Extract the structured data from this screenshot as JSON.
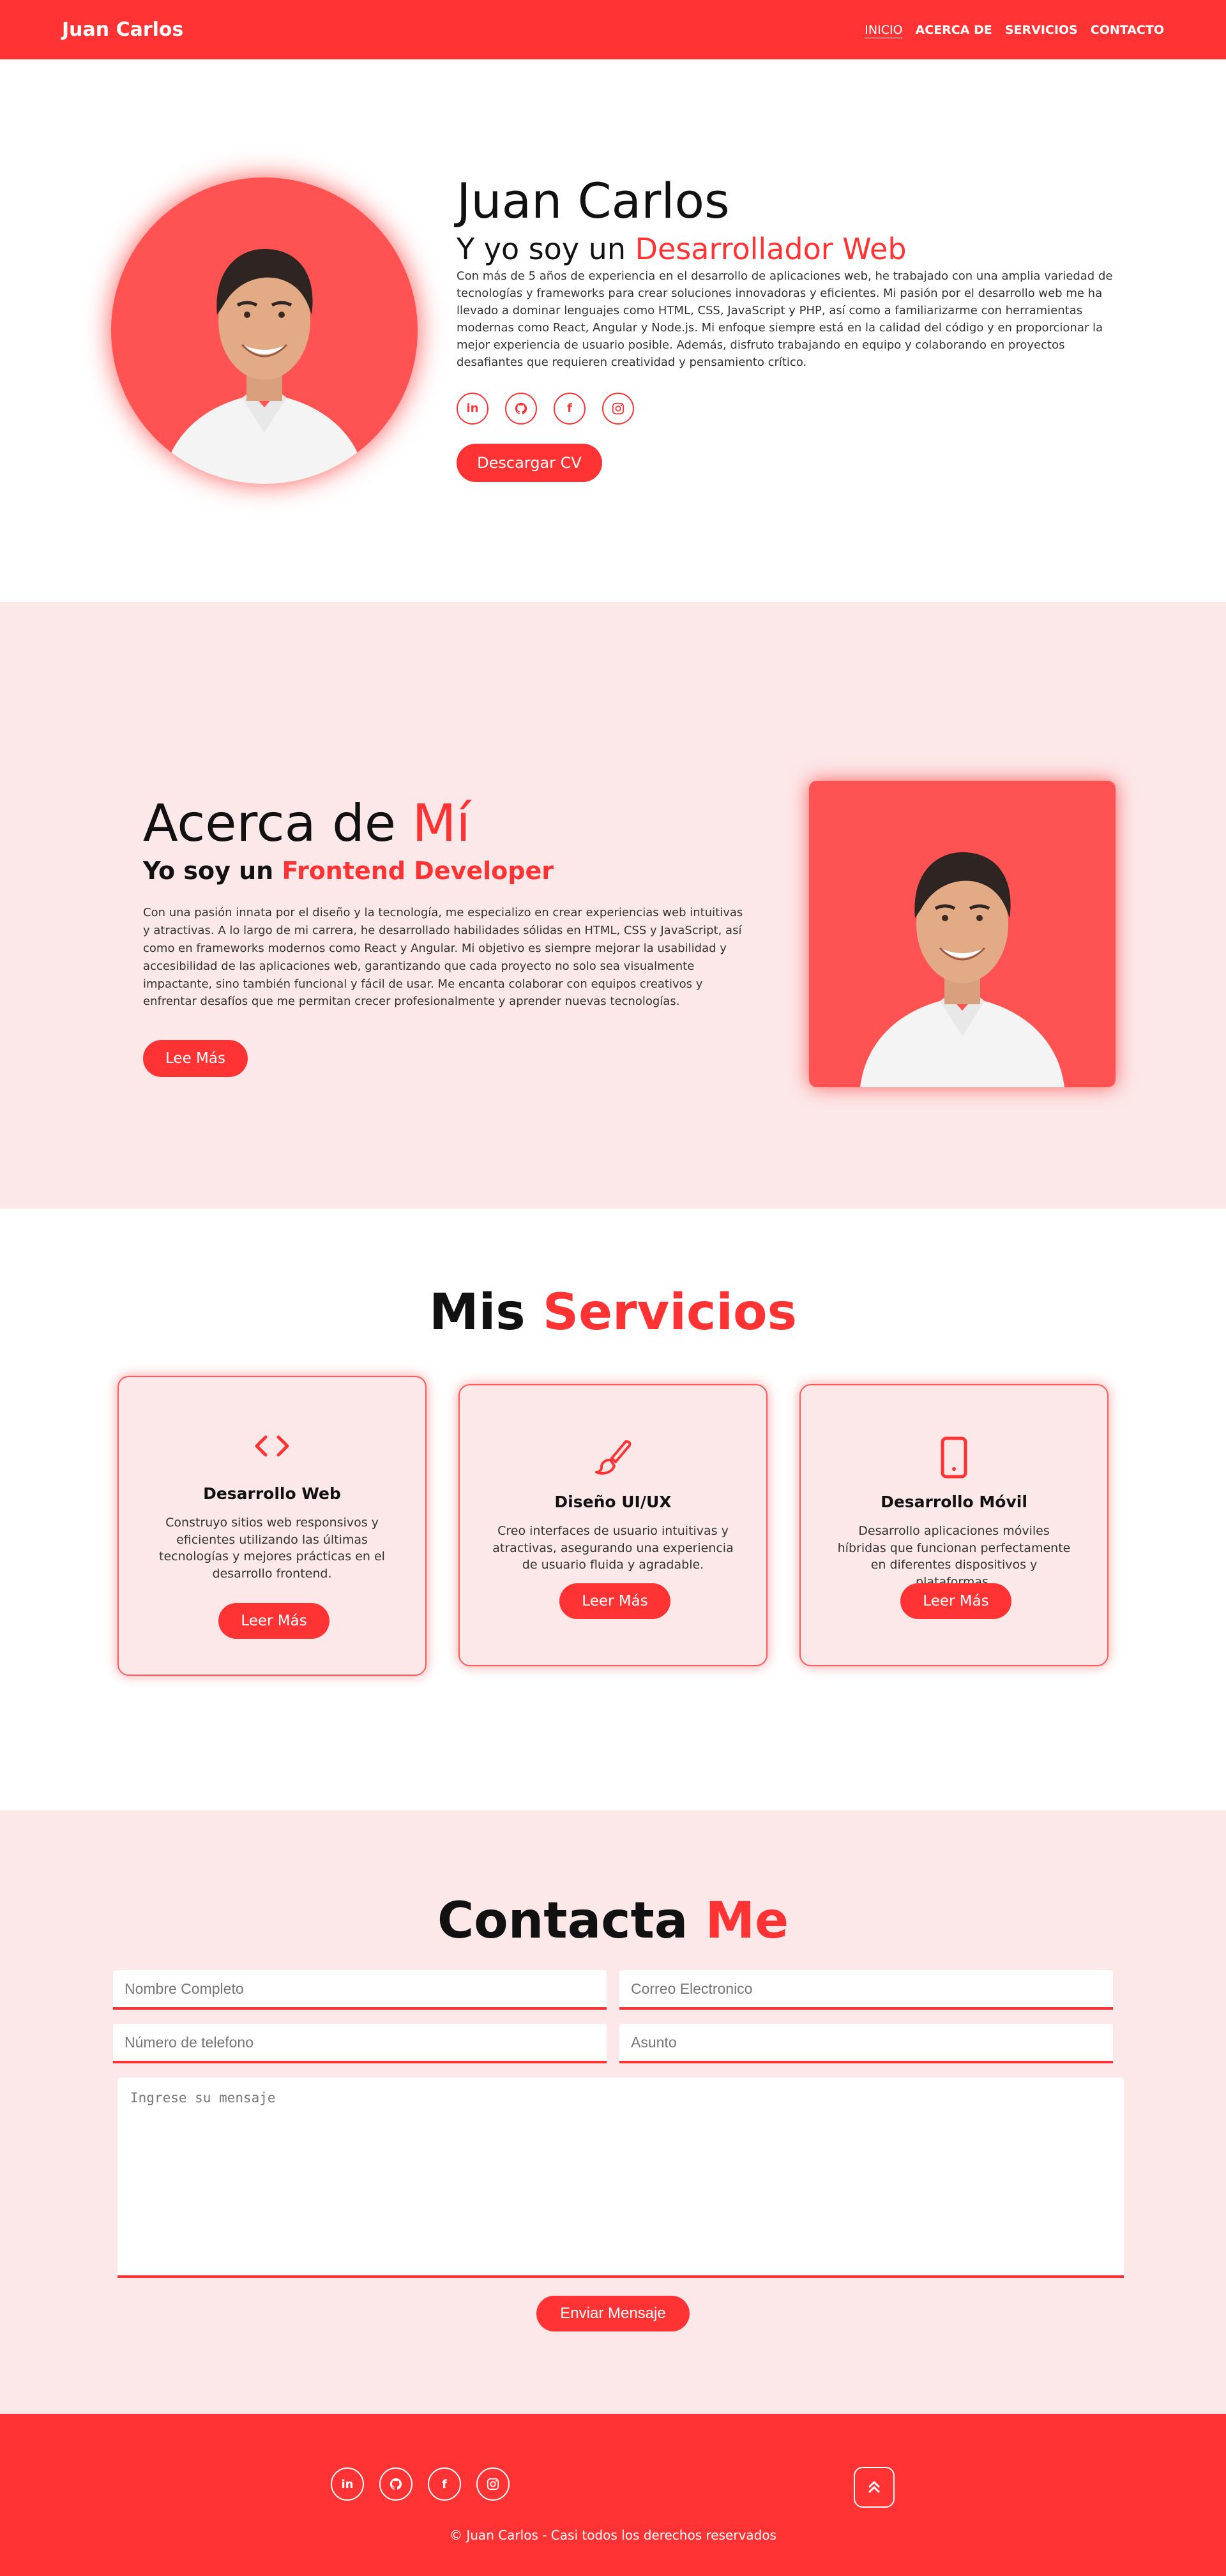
{
  "colors": {
    "accent": "#ff3333",
    "accent_light": "#fce8e8",
    "photo_bg": "#ff5252"
  },
  "header": {
    "logo": "Juan Carlos",
    "nav": [
      {
        "label": "INICIO",
        "active": true
      },
      {
        "label": "ACERCA DE"
      },
      {
        "label": "SERVICIOS"
      },
      {
        "label": "CONTACTO"
      }
    ]
  },
  "hero": {
    "name": "Juan Carlos",
    "role_prefix": "Y yo soy un",
    "role_accent": "Desarrollador Web",
    "description": "Con más de 5 años de experiencia en el desarrollo de aplicaciones web, he trabajado con una amplia variedad de tecnologías y frameworks para crear soluciones innovadoras y eficientes. Mi pasión por el desarrollo web me ha llevado a dominar lenguajes como HTML, CSS, JavaScript y PHP, así como a familiarizarme con herramientas modernas como React, Angular y Node.js. Mi enfoque siempre está en la calidad del código y en proporcionar la mejor experiencia de usuario posible. Además, disfruto trabajando en equipo y colaborando en proyectos desafiantes que requieren creatividad y pensamiento crítico.",
    "socials": [
      "linkedin-icon",
      "github-icon",
      "facebook-icon",
      "instagram-icon"
    ],
    "cv_button": "Descargar CV"
  },
  "about": {
    "title_prefix": "Acerca de",
    "title_accent": "Mí",
    "sub_prefix": "Yo soy un",
    "sub_accent": "Frontend Developer",
    "description": "Con una pasión innata por el diseño y la tecnología, me especializo en crear experiencias web intuitivas y atractivas. A lo largo de mi carrera, he desarrollado habilidades sólidas en HTML, CSS y JavaScript, así como en frameworks modernos como React y Angular. Mi objetivo es siempre mejorar la usabilidad y accesibilidad de las aplicaciones web, garantizando que cada proyecto no solo sea visualmente impactante, sino también funcional y fácil de usar. Me encanta colaborar con equipos creativos y enfrentar desafíos que me permitan crecer profesionalmente y aprender nuevas tecnologías.",
    "button": "Lee Más"
  },
  "services": {
    "title_prefix": "Mis",
    "title_accent": "Servicios",
    "cards": [
      {
        "icon": "code-icon",
        "title": "Desarrollo Web",
        "description": "Construyo sitios web responsivos y eficientes utilizando las últimas tecnologías y mejores prácticas en el desarrollo frontend.",
        "button": "Leer Más"
      },
      {
        "icon": "paintbrush-icon",
        "title": "Diseño UI/UX",
        "description": "Creo interfaces de usuario intuitivas y atractivas, asegurando una experiencia de usuario fluida y agradable.",
        "button": "Leer Más"
      },
      {
        "icon": "mobile-phone-icon",
        "title": "Desarrollo Móvil",
        "description": "Desarrollo aplicaciones móviles híbridas que funcionan perfectamente en diferentes dispositivos y plataformas.",
        "button": "Leer Más"
      }
    ]
  },
  "contact": {
    "title_prefix": "Contacta",
    "title_accent": "Me",
    "fields": {
      "name": "Nombre Completo",
      "email": "Correo Electronico",
      "phone": "Número de telefono",
      "subject": "Asunto",
      "message": "Ingrese su mensaje"
    },
    "button": "Enviar Mensaje"
  },
  "footer": {
    "socials": [
      "linkedin-icon",
      "github-icon",
      "facebook-icon",
      "instagram-icon"
    ],
    "scroll_top_icon": "double-chevron-up-icon",
    "copyright": "© Juan Carlos - Casi todos los derechos reservados"
  }
}
